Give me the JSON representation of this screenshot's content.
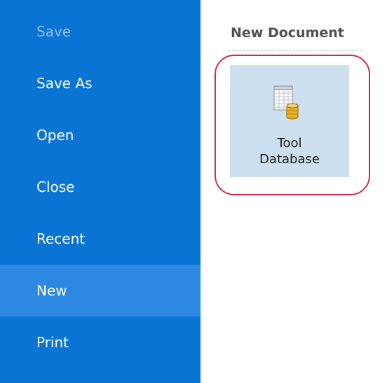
{
  "sidebar": {
    "items": [
      {
        "label": "Save",
        "state": "disabled"
      },
      {
        "label": "Save As",
        "state": "normal"
      },
      {
        "label": "Open",
        "state": "normal"
      },
      {
        "label": "Close",
        "state": "normal"
      },
      {
        "label": "Recent",
        "state": "normal"
      },
      {
        "label": "New",
        "state": "selected"
      },
      {
        "label": "Print",
        "state": "normal"
      }
    ]
  },
  "main": {
    "section_title": "New Document",
    "tile": {
      "label_line1": "Tool",
      "label_line2": "Database",
      "icon": "spreadsheet-database-icon"
    }
  },
  "colors": {
    "sidebar_bg": "#0a74d4",
    "selected_bg": "#2c88e0",
    "tile_bg": "#cce0f0",
    "highlight_ring": "#d8274d"
  }
}
